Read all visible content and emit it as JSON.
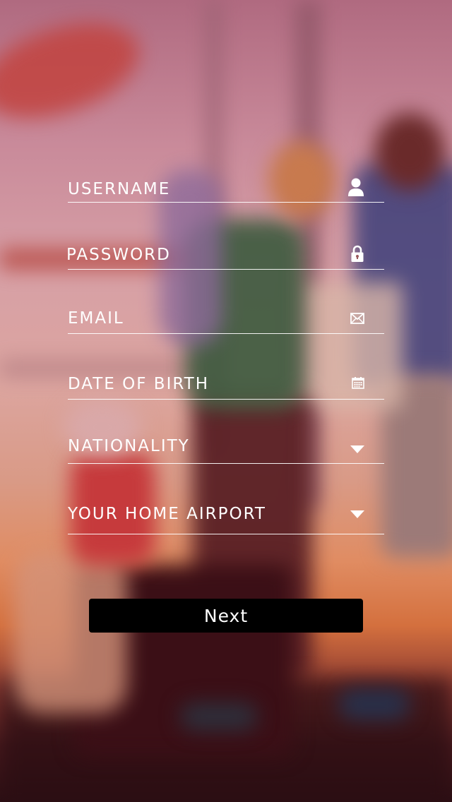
{
  "form": {
    "fields": [
      {
        "label": "USERNAME",
        "icon": "user-icon",
        "type": "text"
      },
      {
        "label": "PASSWORD",
        "icon": "lock-icon",
        "type": "password"
      },
      {
        "label": "EMAIL",
        "icon": "envelope-icon",
        "type": "email"
      },
      {
        "label": "DATE OF BIRTH",
        "icon": "calendar-icon",
        "type": "date"
      },
      {
        "label": "NATIONALITY",
        "icon": "chevron-down-icon",
        "type": "select"
      },
      {
        "label": "YOUR HOME AIRPORT",
        "icon": "chevron-down-icon",
        "type": "select"
      }
    ],
    "next_label": "Next"
  },
  "colors": {
    "text": "#ffffff",
    "underline": "#ffffff",
    "button_bg": "#000000",
    "button_text": "#ffffff"
  }
}
